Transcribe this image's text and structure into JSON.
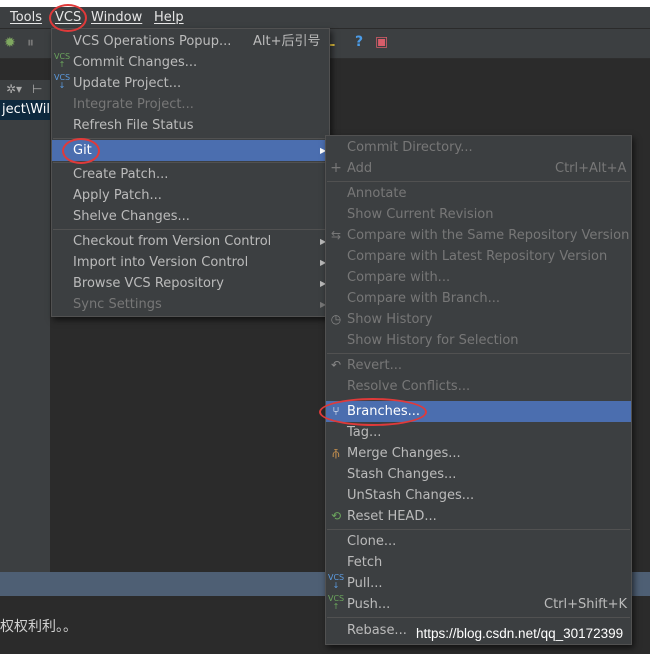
{
  "menubar": {
    "items": [
      {
        "label": "Tools"
      },
      {
        "label": "VCS"
      },
      {
        "label": "Window"
      },
      {
        "label": "Help"
      }
    ]
  },
  "project_path": "ject\\Wil",
  "vcs_menu": {
    "items": [
      {
        "label": "VCS Operations Popup...",
        "shortcut": "Alt+后引号"
      },
      {
        "label": "Commit Changes..."
      },
      {
        "label": "Update Project..."
      },
      {
        "label": "Integrate Project..."
      },
      {
        "label": "Refresh File Status"
      },
      {
        "label": "Git"
      },
      {
        "label": "Create Patch..."
      },
      {
        "label": "Apply Patch..."
      },
      {
        "label": "Shelve Changes..."
      },
      {
        "label": "Checkout from Version Control"
      },
      {
        "label": "Import into Version Control"
      },
      {
        "label": "Browse VCS Repository"
      },
      {
        "label": "Sync Settings"
      }
    ]
  },
  "git_menu": {
    "items": [
      {
        "label": "Commit Directory..."
      },
      {
        "label": "Add",
        "shortcut": "Ctrl+Alt+A"
      },
      {
        "label": "Annotate"
      },
      {
        "label": "Show Current Revision"
      },
      {
        "label": "Compare with the Same Repository Version"
      },
      {
        "label": "Compare with Latest Repository Version"
      },
      {
        "label": "Compare with..."
      },
      {
        "label": "Compare with Branch..."
      },
      {
        "label": "Show History"
      },
      {
        "label": "Show History for Selection"
      },
      {
        "label": "Revert..."
      },
      {
        "label": "Resolve Conflicts..."
      },
      {
        "label": "Branches..."
      },
      {
        "label": "Tag..."
      },
      {
        "label": "Merge Changes..."
      },
      {
        "label": "Stash Changes..."
      },
      {
        "label": "UnStash Changes..."
      },
      {
        "label": "Reset HEAD..."
      },
      {
        "label": "Clone..."
      },
      {
        "label": "Fetch"
      },
      {
        "label": "Pull..."
      },
      {
        "label": "Push...",
        "shortcut": "Ctrl+Shift+K"
      },
      {
        "label": "Rebase..."
      }
    ]
  },
  "bottom_text": "权权利利。。",
  "watermark": "https://blog.csdn.net/qq_30172399",
  "colors": {
    "menu_bg": "#3c3f41",
    "selection": "#4b6eaf",
    "highlight_circle": "#e03a3a"
  }
}
